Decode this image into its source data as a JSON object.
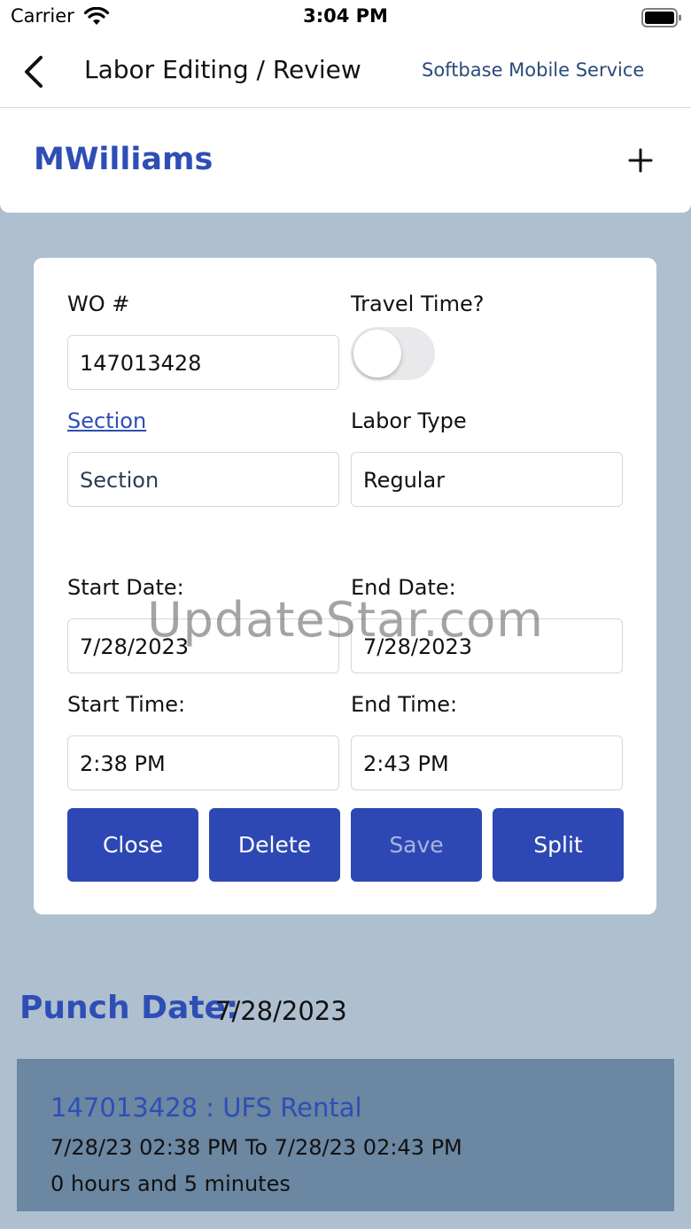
{
  "status_bar": {
    "carrier": "Carrier",
    "time": "3:04 PM"
  },
  "nav": {
    "title": "Labor Editing / Review",
    "app_name": "Softbase Mobile Service"
  },
  "header": {
    "user_name": "MWilliams"
  },
  "form": {
    "wo_label": "WO #",
    "wo_value": "147013428",
    "travel_label": "Travel Time?",
    "travel_on": false,
    "section_label": "Section",
    "section_placeholder": "Section",
    "labor_type_label": "Labor Type",
    "labor_type_value": "Regular",
    "start_date_label": "Start Date:",
    "start_date_value": "7/28/2023",
    "end_date_label": "End Date:",
    "end_date_value": "7/28/2023",
    "start_time_label": "Start Time:",
    "start_time_value": "2:38 PM",
    "end_time_label": "End Time:",
    "end_time_value": "2:43 PM"
  },
  "buttons": {
    "close": "Close",
    "delete": "Delete",
    "save": "Save",
    "split": "Split"
  },
  "watermark": "UpdateStar.com",
  "punch": {
    "label": "Punch Date:",
    "date": "7/28/2023",
    "entry": {
      "title": "147013428 : UFS Rental",
      "range": "7/28/23 02:38 PM To 7/28/23 02:43 PM",
      "duration": "0 hours and 5 minutes"
    }
  },
  "icons": {
    "back": "chevron-left-icon",
    "add": "plus-icon",
    "wifi": "wifi-icon",
    "battery": "battery-icon"
  },
  "colors": {
    "accent": "#2e4eb6",
    "button": "#2d48b4",
    "background": "#aebfd0",
    "entry_bg": "#6b87a1"
  }
}
